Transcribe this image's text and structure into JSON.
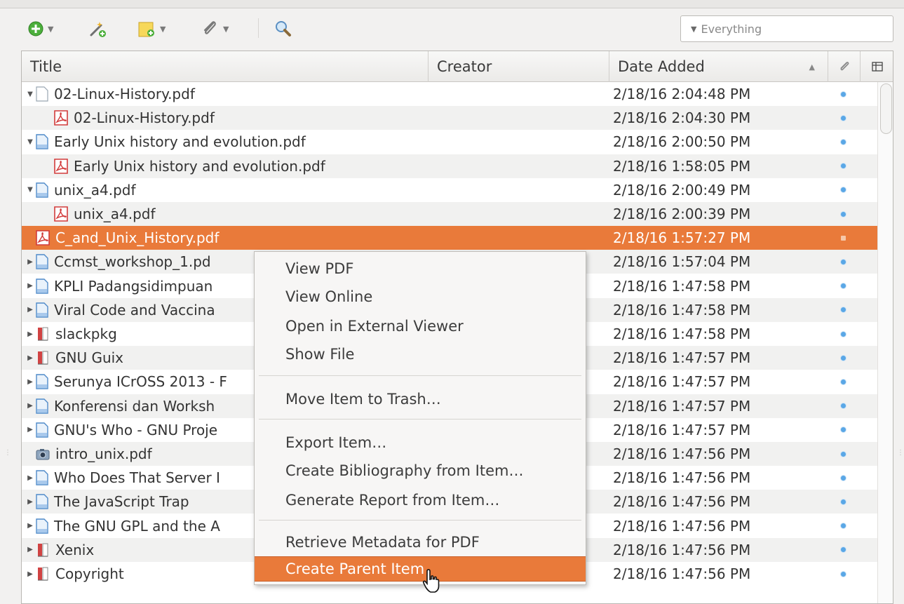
{
  "toolbar": {
    "search_placeholder": "Everything",
    "buttons": [
      {
        "name": "new-item",
        "icon": "plus-circle-icon"
      },
      {
        "name": "add-by-identifier",
        "icon": "magic-wand-icon"
      },
      {
        "name": "new-note",
        "icon": "note-icon"
      },
      {
        "name": "add-attachment",
        "icon": "paperclip-icon"
      },
      {
        "name": "advanced-search",
        "icon": "magnifier-icon"
      }
    ]
  },
  "columns": {
    "title": "Title",
    "creator": "Creator",
    "date_added": "Date Added"
  },
  "rows": [
    {
      "title": "02-Linux-History.pdf",
      "date": "2/18/16 2:04:48 PM"
    },
    {
      "title": "02-Linux-History.pdf",
      "date": "2/18/16 2:04:30 PM"
    },
    {
      "title": "Early Unix history and evolution.pdf",
      "date": "2/18/16 2:00:50 PM"
    },
    {
      "title": "Early Unix history and evolution.pdf",
      "date": "2/18/16 1:58:05 PM"
    },
    {
      "title": "unix_a4.pdf",
      "date": "2/18/16 2:00:49 PM"
    },
    {
      "title": "unix_a4.pdf",
      "date": "2/18/16 2:00:39 PM"
    },
    {
      "title": "C_and_Unix_History.pdf",
      "date": "2/18/16 1:57:27 PM"
    },
    {
      "title": "Ccmst_workshop_1.pd",
      "date": "2/18/16 1:57:04 PM"
    },
    {
      "title": "KPLI Padangsidimpuan",
      "date": "2/18/16 1:47:58 PM"
    },
    {
      "title": "Viral Code and Vaccina",
      "date": "2/18/16 1:47:58 PM"
    },
    {
      "title": "slackpkg",
      "date": "2/18/16 1:47:58 PM"
    },
    {
      "title": "GNU Guix",
      "date": "2/18/16 1:47:57 PM"
    },
    {
      "title": "Serunya ICrOSS 2013 - F",
      "date": "2/18/16 1:47:57 PM"
    },
    {
      "title": "Konferensi dan Worksh",
      "date": "2/18/16 1:47:57 PM"
    },
    {
      "title": "GNU's Who - GNU Proje",
      "date": "2/18/16 1:47:57 PM"
    },
    {
      "title": "intro_unix.pdf",
      "date": "2/18/16 1:47:56 PM"
    },
    {
      "title": "Who Does That Server I",
      "date": "2/18/16 1:47:56 PM"
    },
    {
      "title": "The JavaScript Trap",
      "date": "2/18/16 1:47:56 PM"
    },
    {
      "title": "The GNU GPL and the A",
      "date": "2/18/16 1:47:56 PM"
    },
    {
      "title": "Xenix",
      "date": "2/18/16 1:47:56 PM"
    },
    {
      "title": "Copyright",
      "date": "2/18/16 1:47:56 PM"
    }
  ],
  "context_menu": {
    "view_pdf": "View PDF",
    "view_online": "View Online",
    "open_external": "Open in External Viewer",
    "show_file": "Show File",
    "move_to_trash": "Move Item to Trash…",
    "export_item": "Export Item…",
    "create_bibliography": "Create Bibliography from Item…",
    "generate_report": "Generate Report from Item…",
    "retrieve_metadata": "Retrieve Metadata for PDF",
    "create_parent": "Create Parent Item"
  },
  "colors": {
    "selection": "#e97a3a",
    "attachment_dot": "#5aa7e6",
    "pdf_icon": "#d23b3b"
  }
}
